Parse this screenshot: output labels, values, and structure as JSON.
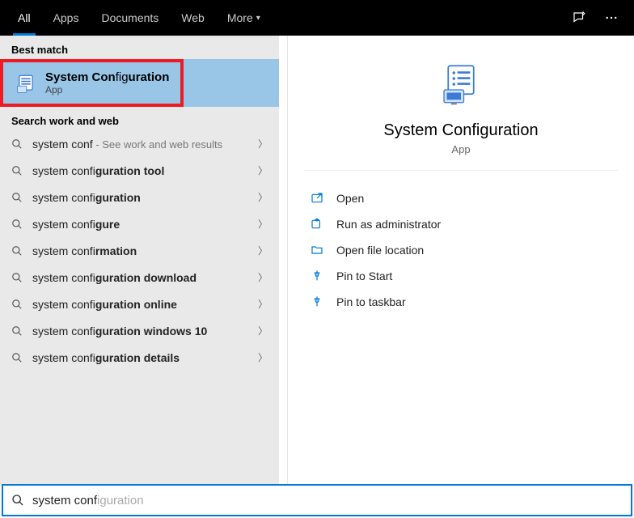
{
  "topbar": {
    "tabs": [
      "All",
      "Apps",
      "Documents",
      "Web",
      "More"
    ],
    "active": 0
  },
  "left": {
    "best_match_header": "Best match",
    "best_match": {
      "title": "System Configuration",
      "subtitle": "App"
    },
    "search_header": "Search work and web",
    "suggestions": [
      {
        "prefix": "system conf",
        "bold": "",
        "hint": " - See work and web results"
      },
      {
        "prefix": "system confi",
        "bold": "guration tool",
        "hint": ""
      },
      {
        "prefix": "system confi",
        "bold": "guration",
        "hint": ""
      },
      {
        "prefix": "system confi",
        "bold": "gure",
        "hint": ""
      },
      {
        "prefix": "system confi",
        "bold": "rmation",
        "hint": ""
      },
      {
        "prefix": "system confi",
        "bold": "guration download",
        "hint": ""
      },
      {
        "prefix": "system confi",
        "bold": "guration online",
        "hint": ""
      },
      {
        "prefix": "system confi",
        "bold": "guration windows 10",
        "hint": ""
      },
      {
        "prefix": "system confi",
        "bold": "guration details",
        "hint": ""
      }
    ]
  },
  "right": {
    "title": "System Configuration",
    "subtitle": "App",
    "actions": [
      "Open",
      "Run as administrator",
      "Open file location",
      "Pin to Start",
      "Pin to taskbar"
    ]
  },
  "search": {
    "typed": "system conf",
    "ghost": "iguration"
  }
}
